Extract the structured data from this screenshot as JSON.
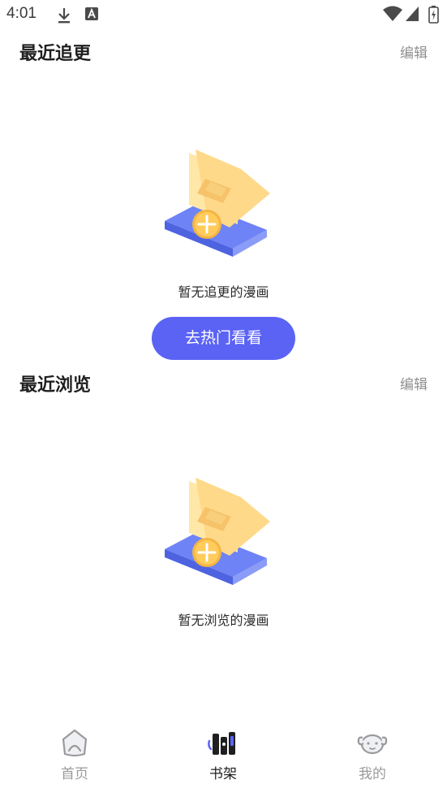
{
  "status_bar": {
    "time": "4:01",
    "left_icons": [
      "download-icon",
      "font-a-icon"
    ],
    "right_icons": [
      "wifi-icon",
      "cell-signal-icon",
      "battery-charging-icon"
    ]
  },
  "recent_updates": {
    "title": "最近追更",
    "edit_label": "编辑",
    "empty_text": "暂无追更的漫画",
    "cta_label": "去热门看看"
  },
  "recent_browse": {
    "title": "最近浏览",
    "edit_label": "编辑",
    "empty_text": "暂无浏览的漫画"
  },
  "tab_bar": {
    "tabs": [
      {
        "label": "首页",
        "icon": "home-icon",
        "active": false
      },
      {
        "label": "书架",
        "icon": "bookshelf-icon",
        "active": true
      },
      {
        "label": "我的",
        "icon": "profile-dog-icon",
        "active": false
      }
    ]
  },
  "colors": {
    "accent": "#5b63f5",
    "muted_text": "#8f8f8f",
    "book_yellow": "#ffd98a",
    "book_blue": "#6e83f5"
  }
}
